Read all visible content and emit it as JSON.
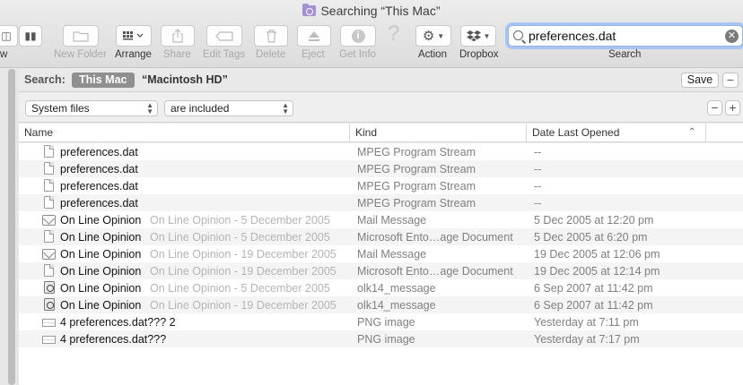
{
  "window": {
    "title": "Searching “This Mac”"
  },
  "toolbar": {
    "items": [
      {
        "label": "w"
      },
      {
        "label": "New Folder"
      },
      {
        "label": "Arrange"
      },
      {
        "label": "Share"
      },
      {
        "label": "Edit Tags"
      },
      {
        "label": "Delete"
      },
      {
        "label": "Eject"
      },
      {
        "label": "Get Info"
      },
      {
        "label": "Action"
      },
      {
        "label": "Dropbox"
      },
      {
        "label": "Search"
      }
    ],
    "search_value": "preferences.dat",
    "help_glyph": "?"
  },
  "scope_bar": {
    "label": "Search:",
    "this_mac": "This Mac",
    "volume": "“Macintosh HD”",
    "save_label": "Save",
    "minus": "−"
  },
  "criteria": {
    "attribute": "System files",
    "operator": "are included",
    "minus": "−",
    "plus": "+"
  },
  "columns": {
    "name": "Name",
    "kind": "Kind",
    "date": "Date Last Opened"
  },
  "rows": [
    {
      "name": "preferences.dat",
      "sub": "",
      "kind": "MPEG Program Stream",
      "date": "--",
      "icon": "doc-icon"
    },
    {
      "name": "preferences.dat",
      "sub": "",
      "kind": "MPEG Program Stream",
      "date": "--",
      "icon": "doc-icon"
    },
    {
      "name": "preferences.dat",
      "sub": "",
      "kind": "MPEG Program Stream",
      "date": "--",
      "icon": "doc-icon"
    },
    {
      "name": "preferences.dat",
      "sub": "",
      "kind": "MPEG Program Stream",
      "date": "--",
      "icon": "doc-icon"
    },
    {
      "name": "On Line Opinion",
      "sub": "On Line Opinion - 5 December 2005",
      "kind": "Mail Message",
      "date": "5 Dec 2005 at 12:20 pm",
      "icon": "mail-icon"
    },
    {
      "name": "On Line Opinion",
      "sub": "On Line Opinion - 5 December 2005",
      "kind": "Microsoft Ento…age Document",
      "date": "5 Dec 2005 at 6:20 pm",
      "icon": "doc-icon"
    },
    {
      "name": "On Line Opinion",
      "sub": "On Line Opinion - 19 December 2005",
      "kind": "Mail Message",
      "date": "19 Dec 2005 at 12:06 pm",
      "icon": "mail-icon"
    },
    {
      "name": "On Line Opinion",
      "sub": "On Line Opinion - 19 December 2005",
      "kind": "Microsoft Ento…age Document",
      "date": "19 Dec 2005 at 12:14 pm",
      "icon": "doc-icon"
    },
    {
      "name": "On Line Opinion",
      "sub": "On Line Opinion - 5 December 2005",
      "kind": "olk14_message",
      "date": "6 Sep 2007 at 11:42 pm",
      "icon": "olk-icon"
    },
    {
      "name": "On Line Opinion",
      "sub": "On Line Opinion - 19 December 2005",
      "kind": "olk14_message",
      "date": "6 Sep 2007 at 11:42 pm",
      "icon": "olk-icon"
    },
    {
      "name": "4 preferences.dat??? 2",
      "sub": "",
      "kind": "PNG image",
      "date": "Yesterday at 7:11 pm",
      "icon": "png-icon"
    },
    {
      "name": "4 preferences.dat???",
      "sub": "",
      "kind": "PNG image",
      "date": "Yesterday at 7:17 pm",
      "icon": "png-icon"
    }
  ]
}
